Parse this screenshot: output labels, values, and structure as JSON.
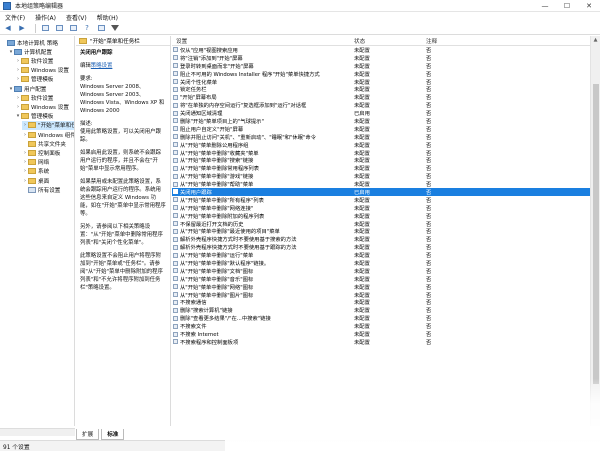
{
  "window": {
    "title": "本地组策略编辑器",
    "controls": [
      "—",
      "☐",
      "✕"
    ]
  },
  "menu": [
    "文件(F)",
    "操作(A)",
    "查看(V)",
    "帮助(H)"
  ],
  "toolbar": [
    "back-icon",
    "forward-icon",
    "folder-icon",
    "list-icon",
    "export-icon",
    "help-icon",
    "properties-icon",
    "filter-icon"
  ],
  "tree": [
    {
      "label": "本地计算机 策略",
      "icon": "pc",
      "level": 0,
      "exp": ""
    },
    {
      "label": "计算机配置",
      "icon": "pc",
      "level": 1,
      "exp": "▾"
    },
    {
      "label": "软件设置",
      "icon": "folder",
      "level": 2,
      "exp": "›"
    },
    {
      "label": "Windows 设置",
      "icon": "folder",
      "level": 2,
      "exp": "›"
    },
    {
      "label": "管理模板",
      "icon": "folder",
      "level": 2,
      "exp": "›"
    },
    {
      "label": "用户配置",
      "icon": "pc",
      "level": 1,
      "exp": "▾"
    },
    {
      "label": "软件设置",
      "icon": "folder",
      "level": 2,
      "exp": "›"
    },
    {
      "label": "Windows 设置",
      "icon": "folder",
      "level": 2,
      "exp": "›"
    },
    {
      "label": "管理模板",
      "icon": "folder",
      "level": 2,
      "exp": "▾"
    },
    {
      "label": "\"开始\"菜单和任务栏",
      "icon": "folder",
      "level": 3,
      "exp": "›",
      "selected": true
    },
    {
      "label": "Windows 组件",
      "icon": "folder",
      "level": 3,
      "exp": "›"
    },
    {
      "label": "共享文件夹",
      "icon": "folder",
      "level": 3,
      "exp": ""
    },
    {
      "label": "控制面板",
      "icon": "folder",
      "level": 3,
      "exp": "›"
    },
    {
      "label": "网络",
      "icon": "folder",
      "level": 3,
      "exp": "›"
    },
    {
      "label": "系统",
      "icon": "folder",
      "level": 3,
      "exp": "›"
    },
    {
      "label": "桌面",
      "icon": "folder",
      "level": 3,
      "exp": "›"
    },
    {
      "label": "所有设置",
      "icon": "doc",
      "level": 3,
      "exp": ""
    }
  ],
  "description": {
    "header": "\"开始\"菜单和任务栏",
    "title": "关闭用户跟踪",
    "edit_link": "策略设置",
    "edit_prefix": "编辑",
    "paragraphs": [
      "要求:\nWindows Server 2008、Windows Server 2003、Windows Vista、Windows XP 和 Windows 2000",
      "描述:\n使用此策略设置，可以关闭用户跟踪。",
      "如果启用此设置，则系统不会跟踪用户运行的程序，并且不会在\"开始\"菜单中显示常用程序。",
      "如果禁用或未配置此策略设置，系统会跟踪用户运行的程序。系统用这些信息来自定义 Windows 功能，如在\"开始\"菜单中显示常用程序等。",
      "另外，请参阅以下相关策略设置：\"从\"开始\"菜单中删除常用程序列表\"和\"关闭个性化菜单\"。",
      "此策略设置不会阻止用户将程序附加到\"开始\"菜单或\"任务栏\"。请参阅\"从\"开始\"菜单中删除附加的程序列表\"和\"不允许将程序附加到任务栏\"策略设置。"
    ]
  },
  "columns": {
    "setting": "设置",
    "state": "状态",
    "comment": "注释"
  },
  "rows": [
    {
      "name": "仅从\"应用\"视图搜索应用",
      "state": "未配置",
      "comment": "否"
    },
    {
      "name": "将\"注销\"添加到\"开始\"屏幕",
      "state": "未配置",
      "comment": "否"
    },
    {
      "name": "登录时转到桌面而非\"开始\"屏幕",
      "state": "未配置",
      "comment": "否"
    },
    {
      "name": "阻止不可用的 Windows Installer 程序\"开始\"菜单快捷方式",
      "state": "未配置",
      "comment": "否"
    },
    {
      "name": "关闭个性化菜单",
      "state": "未配置",
      "comment": "否"
    },
    {
      "name": "锁定任务栏",
      "state": "未配置",
      "comment": "否"
    },
    {
      "name": "\"开始\"屏幕布局",
      "state": "未配置",
      "comment": "否"
    },
    {
      "name": "将\"在单独的内存空间运行\"复选框添加到\"运行\"对话框",
      "state": "未配置",
      "comment": "否"
    },
    {
      "name": "关闭通知区域清理",
      "state": "已启用",
      "comment": "否"
    },
    {
      "name": "删除\"开始\"菜单项目上的\"气球提示\"",
      "state": "未配置",
      "comment": "否"
    },
    {
      "name": "阻止用户自定义\"开始\"屏幕",
      "state": "未配置",
      "comment": "否"
    },
    {
      "name": "删除并阻止访问\"关机\"、\"重新启动\"、\"睡眠\"和\"休眠\"命令",
      "state": "未配置",
      "comment": "否"
    },
    {
      "name": "从\"开始\"菜单删除公用程序组",
      "state": "未配置",
      "comment": "否"
    },
    {
      "name": "从\"开始\"菜单中删除\"收藏夹\"菜单",
      "state": "未配置",
      "comment": "否"
    },
    {
      "name": "从\"开始\"菜单中删除\"搜索\"链接",
      "state": "未配置",
      "comment": "否"
    },
    {
      "name": "从\"开始\"菜单中删除常用程序列表",
      "state": "未配置",
      "comment": "否"
    },
    {
      "name": "从\"开始\"菜单中删除\"游戏\"链接",
      "state": "未配置",
      "comment": "否"
    },
    {
      "name": "从\"开始\"菜单中删除\"帮助\"菜单",
      "state": "未配置",
      "comment": "否"
    },
    {
      "name": "关闭用户跟踪",
      "state": "已启用",
      "comment": "否",
      "selected": true
    },
    {
      "name": "从\"开始\"菜单中删除\"所有程序\"列表",
      "state": "未配置",
      "comment": "否"
    },
    {
      "name": "从\"开始\"菜单中删除\"网络连接\"",
      "state": "未配置",
      "comment": "否"
    },
    {
      "name": "从\"开始\"菜单中删除附加的程序列表",
      "state": "未配置",
      "comment": "否"
    },
    {
      "name": "不保留最近打开文档的历史",
      "state": "未配置",
      "comment": "否"
    },
    {
      "name": "从\"开始\"菜单中删除\"最近使用的项目\"菜单",
      "state": "未配置",
      "comment": "否"
    },
    {
      "name": "解析外壳程序快捷方式时不要使用基于搜索的方法",
      "state": "未配置",
      "comment": "否"
    },
    {
      "name": "解析外壳程序快捷方式时不要使用基于跟踪的方法",
      "state": "未配置",
      "comment": "否"
    },
    {
      "name": "从\"开始\"菜单中删除\"运行\"菜单",
      "state": "未配置",
      "comment": "否"
    },
    {
      "name": "从\"开始\"菜单中删除\"默认程序\"链接。",
      "state": "未配置",
      "comment": "否"
    },
    {
      "name": "从\"开始\"菜单中删除\"文档\"图标",
      "state": "未配置",
      "comment": "否"
    },
    {
      "name": "从\"开始\"菜单中删除\"音乐\"图标",
      "state": "未配置",
      "comment": "否"
    },
    {
      "name": "从\"开始\"菜单中删除\"网络\"图标",
      "state": "未配置",
      "comment": "否"
    },
    {
      "name": "从\"开始\"菜单中删除\"图片\"图标",
      "state": "未配置",
      "comment": "否"
    },
    {
      "name": "不搜索通信",
      "state": "未配置",
      "comment": "否"
    },
    {
      "name": "删除\"搜索计算机\"链接",
      "state": "未配置",
      "comment": "否"
    },
    {
      "name": "删除\"查看更多结果\"/\"在...中搜索\"链接",
      "state": "未配置",
      "comment": "否"
    },
    {
      "name": "不搜索文件",
      "state": "未配置",
      "comment": "否"
    },
    {
      "name": "不搜索 Internet",
      "state": "未配置",
      "comment": "否"
    },
    {
      "name": "不搜索程序和控制面板项",
      "state": "未配置",
      "comment": "否"
    }
  ],
  "tabs": [
    "扩展",
    "标准"
  ],
  "status": "91 个设置"
}
